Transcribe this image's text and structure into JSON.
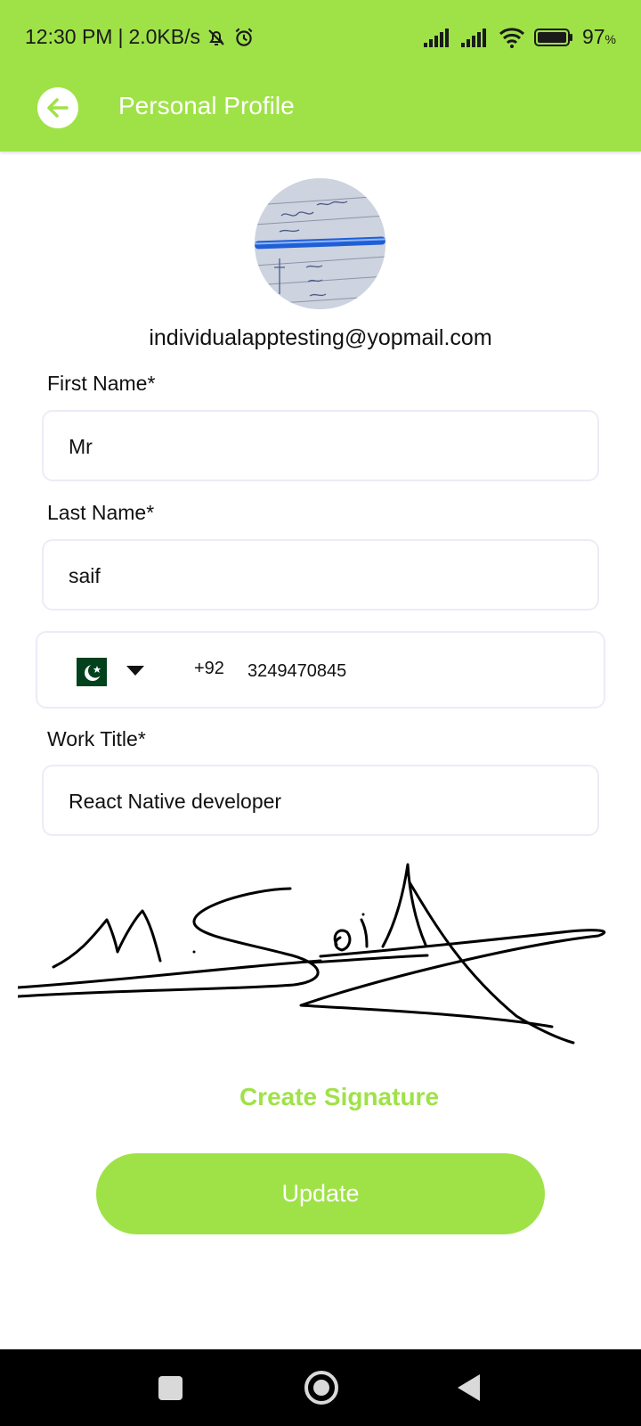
{
  "status_bar": {
    "time": "12:30 PM",
    "speed": "2.0KB/s",
    "battery": "97",
    "battery_unit": "%",
    "icons": [
      "mute-bell-icon",
      "alarm-icon",
      "signal-icon",
      "signal-icon",
      "wifi-icon",
      "battery-icon"
    ]
  },
  "header": {
    "title": "Personal Profile",
    "back_icon": "arrow-left-icon",
    "color": "#9fe247"
  },
  "profile": {
    "email": "individualapptesting@yopmail.com"
  },
  "form": {
    "first_name_label": "First Name*",
    "first_name_value": "Mr",
    "last_name_label": "Last Name*",
    "last_name_value": "saif",
    "phone_country_code": "+92",
    "phone_number": "3249470845",
    "flag_icon": "pakistan-flag-icon",
    "work_title_label": "Work Title*",
    "work_title_value": "React Native developer"
  },
  "signature": {
    "create_label": "Create Signature"
  },
  "actions": {
    "update_label": "Update"
  },
  "nav_bar": {
    "icons": [
      "recents-square-icon",
      "home-circle-icon",
      "back-triangle-icon"
    ]
  },
  "colors": {
    "accent": "#9fe247",
    "input_border": "#ececf7"
  }
}
